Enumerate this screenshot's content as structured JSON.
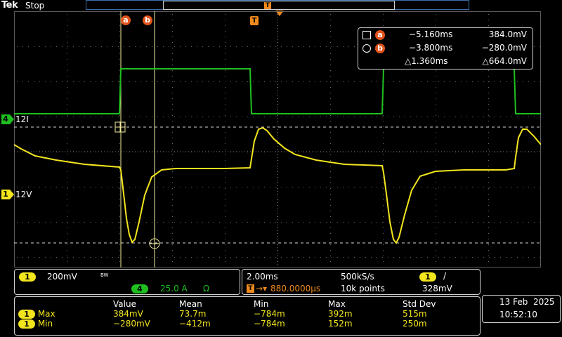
{
  "header": {
    "brand": "Tek",
    "run_state": "Stop"
  },
  "trigger": {
    "marker": "T",
    "position_readout": "880.0000µs"
  },
  "cursors": {
    "a_badge": "a",
    "b_badge": "b",
    "a_time": "−5.160ms",
    "a_value": "384.0mV",
    "b_time": "−3.800ms",
    "b_value": "−280.0mV",
    "delta_time": "△1.360ms",
    "delta_value": "△664.0mV"
  },
  "channels": {
    "ch4": {
      "number": "4",
      "label": "12I",
      "color": "#1fbf1f",
      "scale": "25.0 A",
      "unit_icon": "Ω"
    },
    "ch1": {
      "number": "1",
      "label": "12V",
      "color": "#f2e51d",
      "scale": "200mV",
      "bw_icon": "BW"
    }
  },
  "horizontal": {
    "time_div": "2.00ms",
    "sample_rate": "500kS/s",
    "record_length": "10k points",
    "trigger_channel": "1",
    "trigger_slope": "/",
    "trigger_level": "328mV"
  },
  "measurements": {
    "headers": [
      "Value",
      "Mean",
      "Min",
      "Max",
      "Std Dev"
    ],
    "rows": [
      {
        "channel": "1",
        "name": "Max",
        "values": [
          "384mV",
          "73.7m",
          "−784m",
          "392m",
          "515m"
        ]
      },
      {
        "channel": "1",
        "name": "Min",
        "values": [
          "−280mV",
          "−412m",
          "−784m",
          "152m",
          "250m"
        ]
      }
    ]
  },
  "datetime": {
    "date": "13 Feb  2025",
    "time": "10:52:10"
  }
}
